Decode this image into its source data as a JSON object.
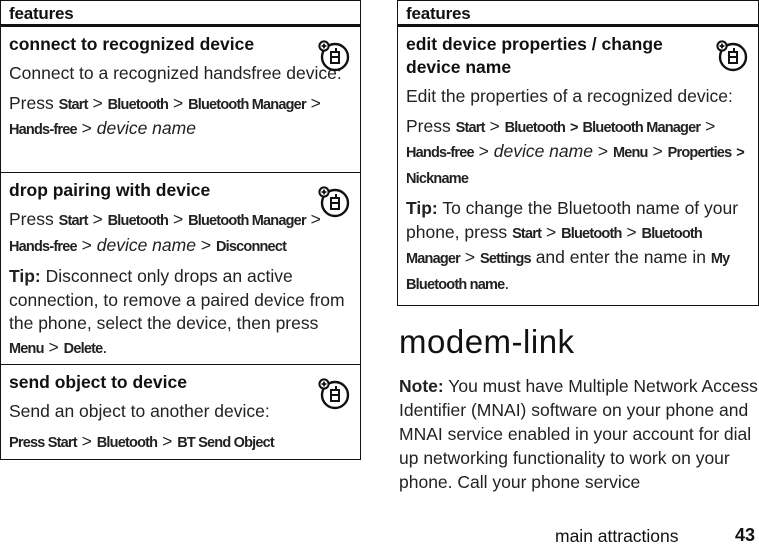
{
  "left_table": {
    "header": "features",
    "rows": [
      {
        "title": "connect to recognized device",
        "icon": "bluetooth-phone-feature-icon",
        "description": "Connect to a recognized handsfree device:",
        "path_prefix": "Press",
        "path": [
          "Start",
          "Bluetooth",
          "Bluetooth Manager",
          "Hands-free"
        ],
        "path_item": "device name"
      },
      {
        "title": "drop pairing with device",
        "icon": "bluetooth-phone-feature-icon",
        "path_prefix": "Press",
        "path": [
          "Start",
          "Bluetooth",
          "Bluetooth Manager",
          "Hands-free"
        ],
        "path_item": "device name",
        "path_end": "Disconnect",
        "tip_label": "Tip:",
        "tip_text": "Disconnect only drops an active connection, to remove a paired device from the phone, select the device, then press",
        "tip_keys": [
          "Menu",
          "Delete"
        ]
      },
      {
        "title": "send object to device",
        "icon": "bluetooth-phone-feature-icon",
        "description": "Send an object to another device:",
        "path": [
          "Press Start",
          "Bluetooth",
          "BT Send Object"
        ]
      }
    ]
  },
  "right_table": {
    "header": "features",
    "rows": [
      {
        "title": "edit device properties / change device name",
        "icon": "bluetooth-phone-feature-icon",
        "description": "Edit the properties of a recognized device:",
        "path_prefix": "Press",
        "path": [
          "Start",
          "Bluetooth",
          "Bluetooth Manager",
          "Hands-free"
        ],
        "path_item": "device name",
        "path_after": [
          "Menu",
          "Properties",
          "Nickname"
        ],
        "tip_label": "Tip:",
        "tip_text_1": "To change the Bluetooth name of your phone, press",
        "tip_keys": [
          "Start",
          "Bluetooth",
          "Bluetooth Manager",
          "Settings"
        ],
        "tip_text_2": "and enter the name in",
        "tip_target": "My Bluetooth name"
      }
    ]
  },
  "section": {
    "heading": "modem-link",
    "note_label": "Note:",
    "note_text": "You must have Multiple Network Access Identifier (MNAI) software on your phone and MNAI service enabled in your account for dial up networking functionality to work on your phone. Call your phone service"
  },
  "footer": {
    "chapter": "main attractions",
    "page_number": "43"
  },
  "separator": ">"
}
